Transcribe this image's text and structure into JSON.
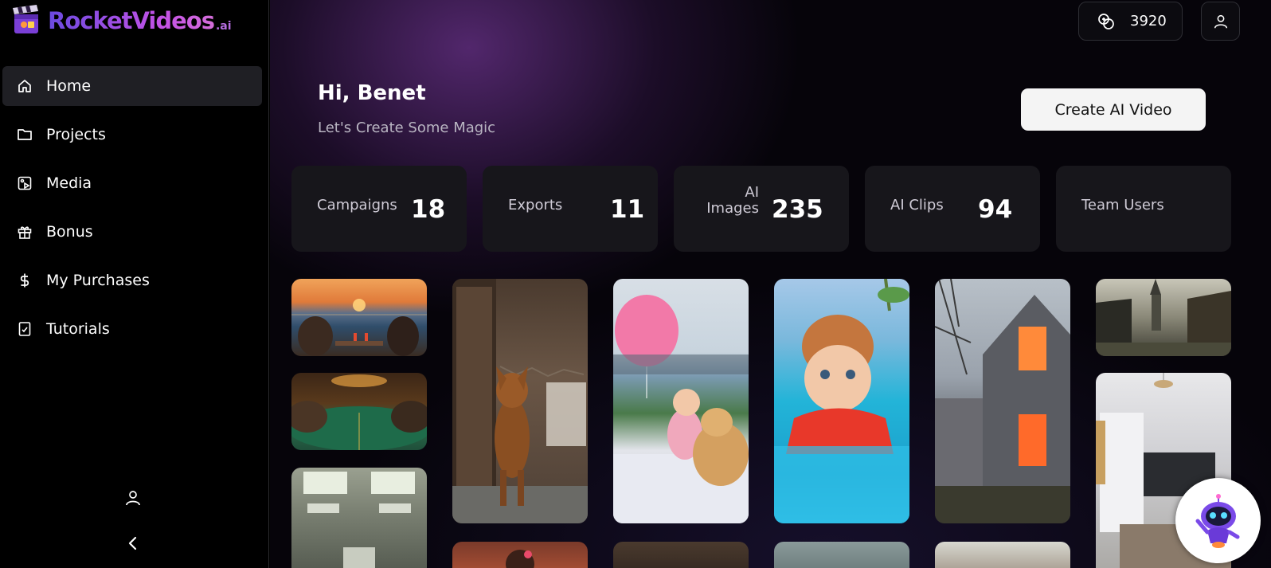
{
  "app": {
    "logo_text": "RocketVideos",
    "logo_suffix": ".ai"
  },
  "sidebar": {
    "items": [
      {
        "label": "Home",
        "icon": "home-icon",
        "active": true
      },
      {
        "label": "Projects",
        "icon": "folder-icon",
        "active": false
      },
      {
        "label": "Media",
        "icon": "media-icon",
        "active": false
      },
      {
        "label": "Bonus",
        "icon": "gift-icon",
        "active": false
      },
      {
        "label": "My Purchases",
        "icon": "dollar-icon",
        "active": false
      },
      {
        "label": "Tutorials",
        "icon": "book-icon",
        "active": false
      }
    ]
  },
  "header": {
    "credits": "3920"
  },
  "main": {
    "greeting": "Hi, Benet",
    "subtitle": "Let's Create Some Magic",
    "create_button": "Create AI Video"
  },
  "stats": [
    {
      "label": "Campaigns",
      "value": "18"
    },
    {
      "label": "Exports",
      "value": "11"
    },
    {
      "label": "AI Images",
      "value": "235"
    },
    {
      "label": "AI Clips",
      "value": "94"
    },
    {
      "label": "Team Users",
      "value": ""
    }
  ],
  "gallery": [
    "couple-at-beach-sunset",
    "card-game-table",
    "office-ceiling-room",
    "dog-in-nursery",
    "baby-with-balloon-and-dog",
    "toddler-in-pool",
    "house-with-lit-windows",
    "asian-village-street",
    "modern-bedroom"
  ],
  "colors": {
    "accent": "#c552e6",
    "sidebar_active": "#1f1f24",
    "card_bg": "#17161b"
  }
}
